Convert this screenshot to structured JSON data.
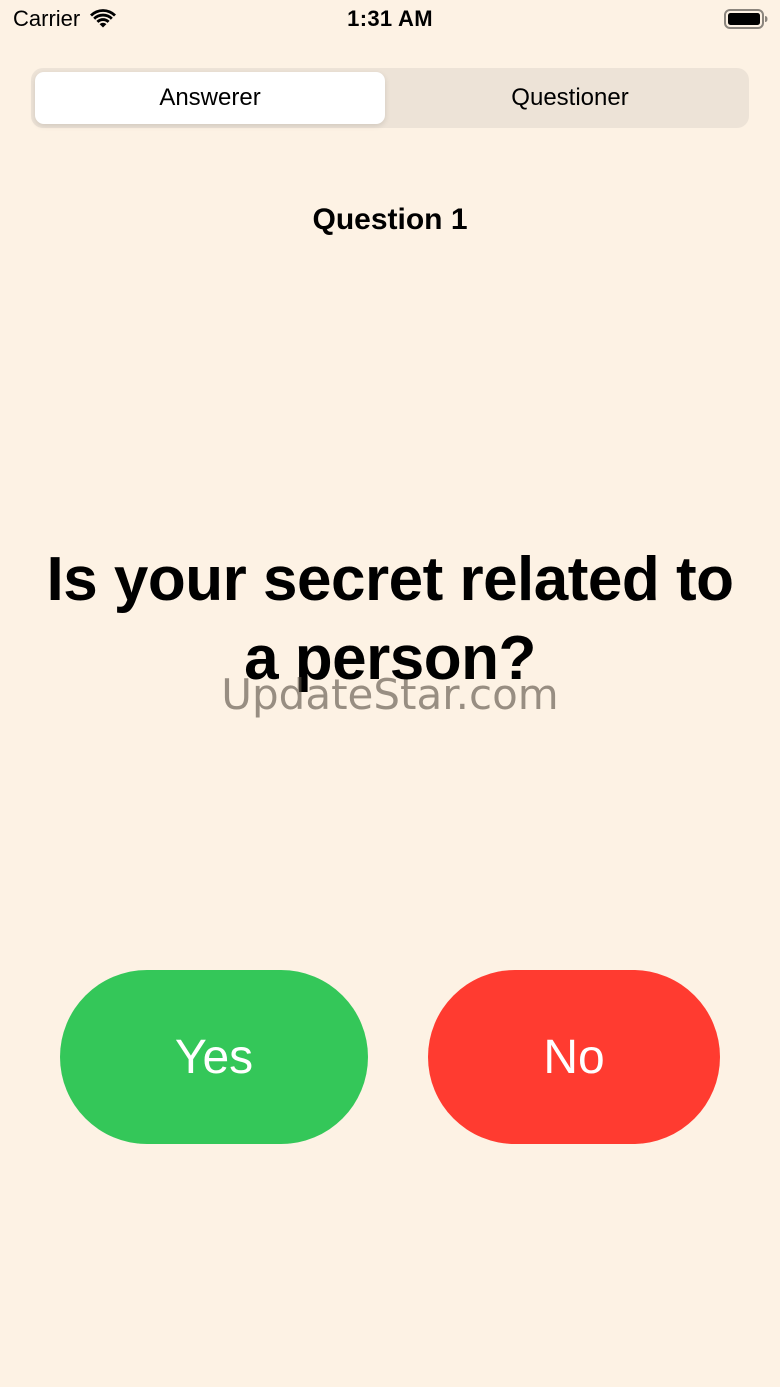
{
  "status_bar": {
    "carrier": "Carrier",
    "time": "1:31 AM",
    "wifi_icon": "wifi-icon",
    "battery_icon": "battery-full-icon"
  },
  "segmented_control": {
    "segments": [
      {
        "label": "Answerer",
        "selected": true
      },
      {
        "label": "Questioner",
        "selected": false
      }
    ]
  },
  "question": {
    "number_label": "Question 1",
    "text": "Is your secret related to a person?"
  },
  "watermark": "UpdateStar.com",
  "buttons": {
    "yes_label": "Yes",
    "no_label": "No"
  },
  "colors": {
    "background": "#fdf2e4",
    "segment_track": "#ede3d7",
    "yes": "#34c759",
    "no": "#ff3b30"
  }
}
